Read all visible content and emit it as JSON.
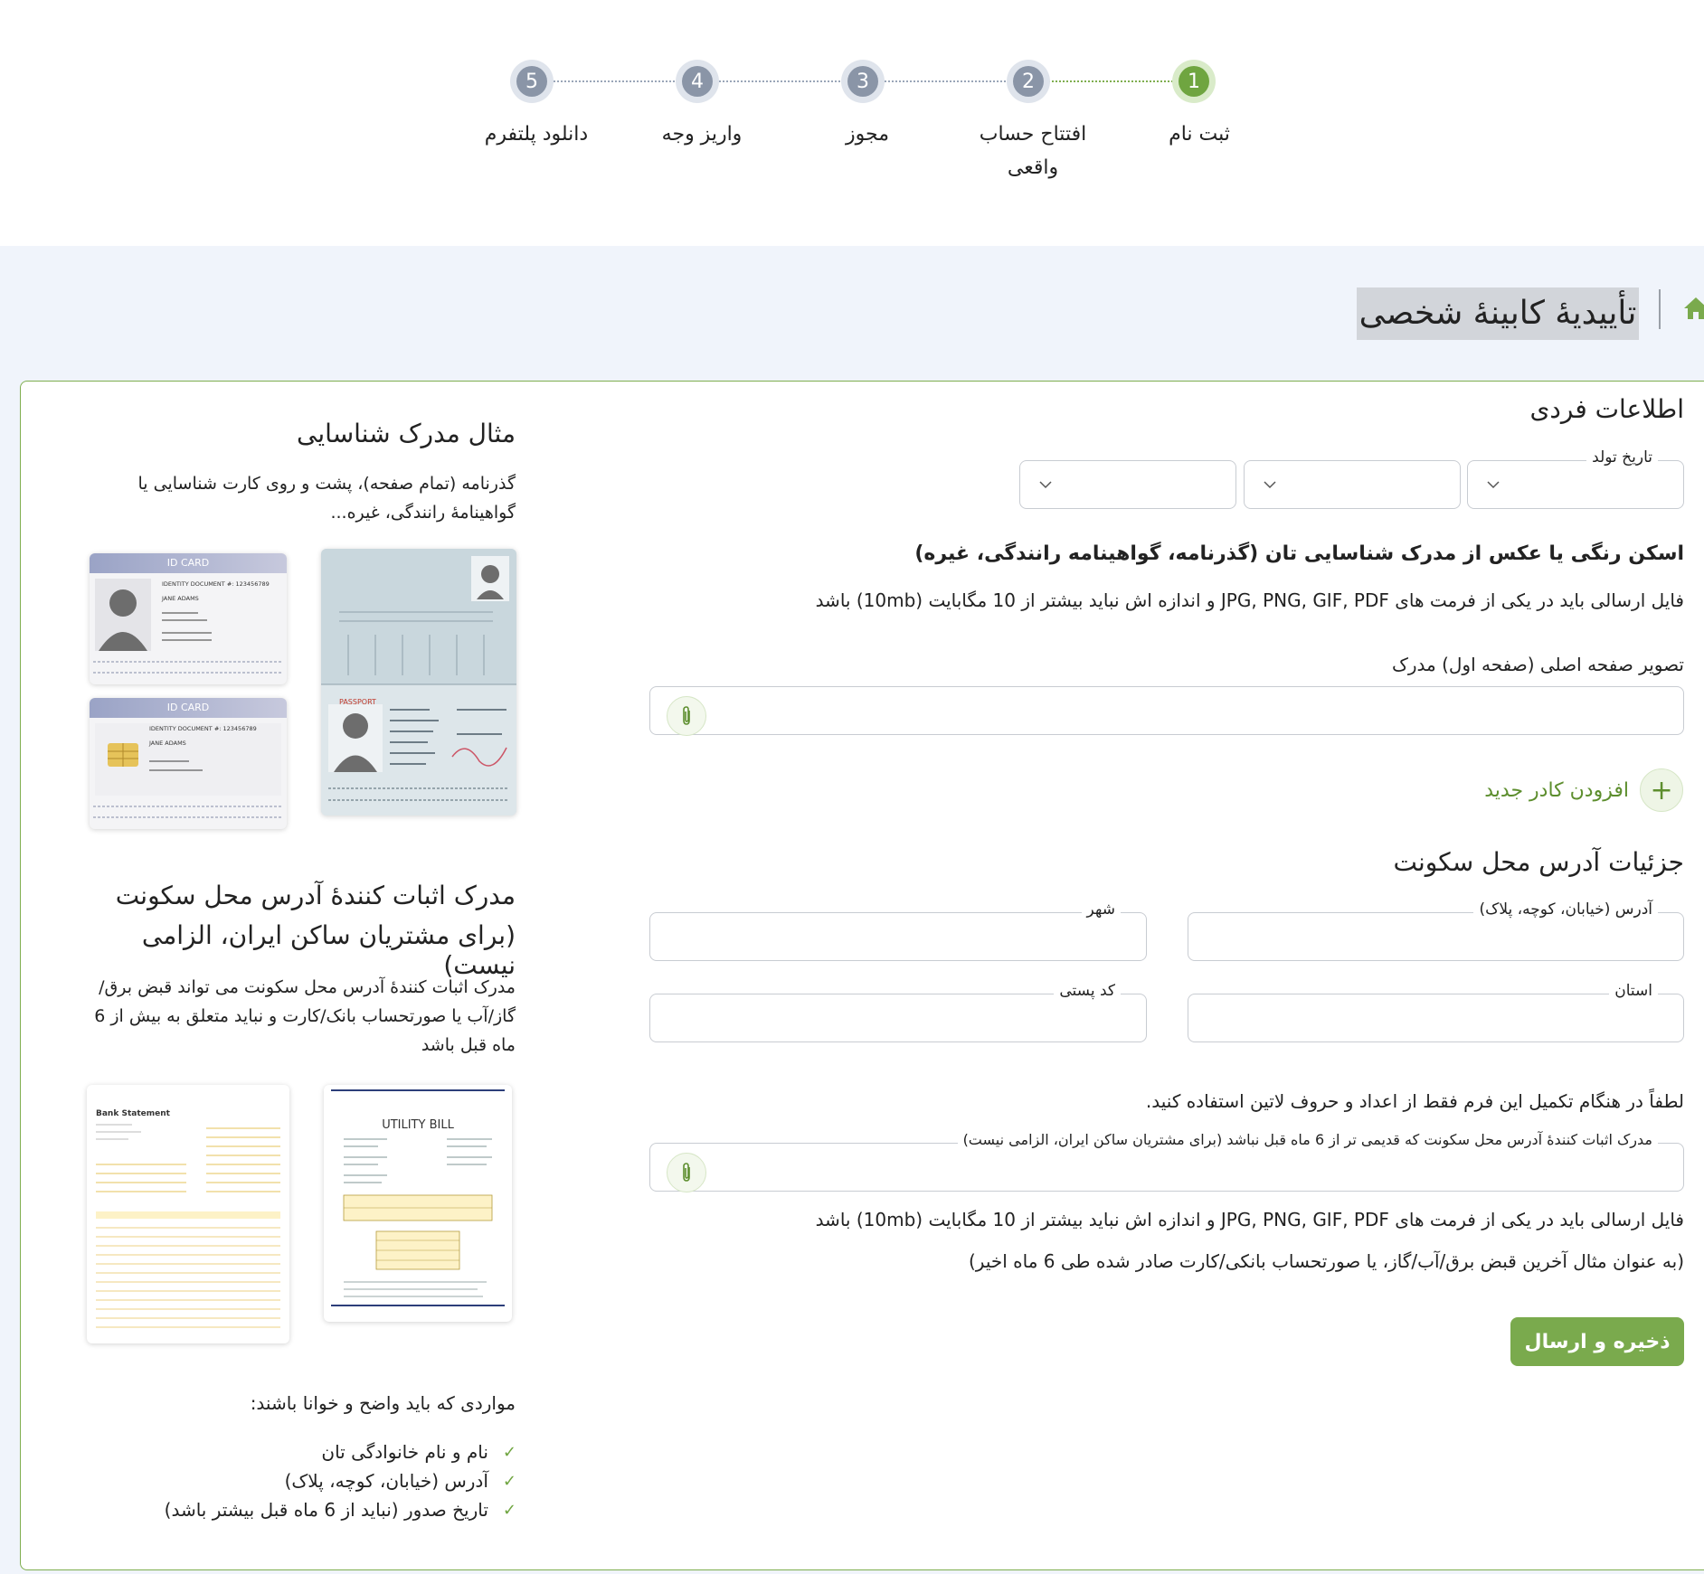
{
  "steps": [
    {
      "number": "1",
      "label": "ثبت نام",
      "active": true
    },
    {
      "number": "2",
      "label": "افتتاح حساب واقعی",
      "active": false
    },
    {
      "number": "3",
      "label": "مجوز",
      "active": false
    },
    {
      "number": "4",
      "label": "واریز وجه",
      "active": false
    },
    {
      "number": "5",
      "label": "دانلود پلتفرم",
      "active": false
    }
  ],
  "page": {
    "title": "تأییدیهٔ کابینهٔ شخصی"
  },
  "personal": {
    "title": "اطلاعات فردی",
    "birth_date_label": "تاریخ تولد",
    "scan_heading": "اسکن رنگی یا عکس از مدرک شناسایی تان (گذرنامه، گواهینامه رانندگی، غیره)",
    "file_note": "فایل ارسالی باید در یکی از فرمت های JPG, PNG, GIF, PDF و اندازه اش نباید بیشتر از 10 مگابایت (10mb) باشد",
    "main_page_label": "تصویر صفحه اصلی (صفحه اول) مدرک",
    "add_frame_label": "افزودن کادر جدید"
  },
  "address": {
    "title": "جزئیات آدرس محل سکونت",
    "street_label": "آدرس (خیابان، کوچه، پلاک)",
    "city_label": "شهر",
    "province_label": "استان",
    "postal_label": "کد پستی",
    "latin_note": "لطفاً در هنگام تکمیل این فرم فقط از اعداد و حروف لاتین استفاده کنید.",
    "proof_label": "مدرک اثبات کنندهٔ آدرس محل سکونت که قدیمی تر از 6 ماه قبل نباشد (برای مشتریان ساکن ایران، الزامی نیست)",
    "file_note": "فایل ارسالی باید در یکی از فرمت های JPG, PNG, GIF, PDF و اندازه اش نباید بیشتر از 10 مگابایت (10mb) باشد",
    "example_note": "(به عنوان مثال آخرین قبض برق/آب/گاز، یا صورتحساب بانکی/کارت صادر شده طی 6 ماه اخیر)",
    "submit_label": "ذخیره و ارسال"
  },
  "sidebar": {
    "id_title": "مثال مدرک شناسایی",
    "id_desc": "گذرنامه (تمام صفحه)، پشت و روی کارت شناسایی یا گواهینامهٔ رانندگی، غیره...",
    "proof_title_1": "مدرک اثبات کنندهٔ آدرس محل سکونت",
    "proof_title_2": "(برای مشتریان ساکن ایران، الزامی نیست)",
    "proof_desc": "مدرک اثبات کنندهٔ آدرس محل سکونت می تواند قبض برق/گاز/آب یا صورتحساب بانک/کارت و نباید متعلق به بیش از 6 ماه قبل باشد",
    "requirements_title": "مواردی که باید واضح و خوانا باشند:",
    "requirements": [
      "نام و نام خانوادگی تان",
      "آدرس (خیابان، کوچه، پلاک)",
      "تاریخ صدور (نباید از 6 ماه قبل بیشتر باشد)"
    ]
  },
  "samples": {
    "id_card_header": "ID CARD",
    "id_card_number": "IDENTITY DOCUMENT #: 123456789",
    "id_card_name": "JANE ADAMS",
    "passport_label": "PASSPORT",
    "utility_title": "UTILITY BILL",
    "bank_title": "Bank Statement"
  },
  "colors": {
    "accent": "#7aaa4d",
    "step_inactive": "#8a95a7",
    "page_bg": "#f0f4fb"
  }
}
